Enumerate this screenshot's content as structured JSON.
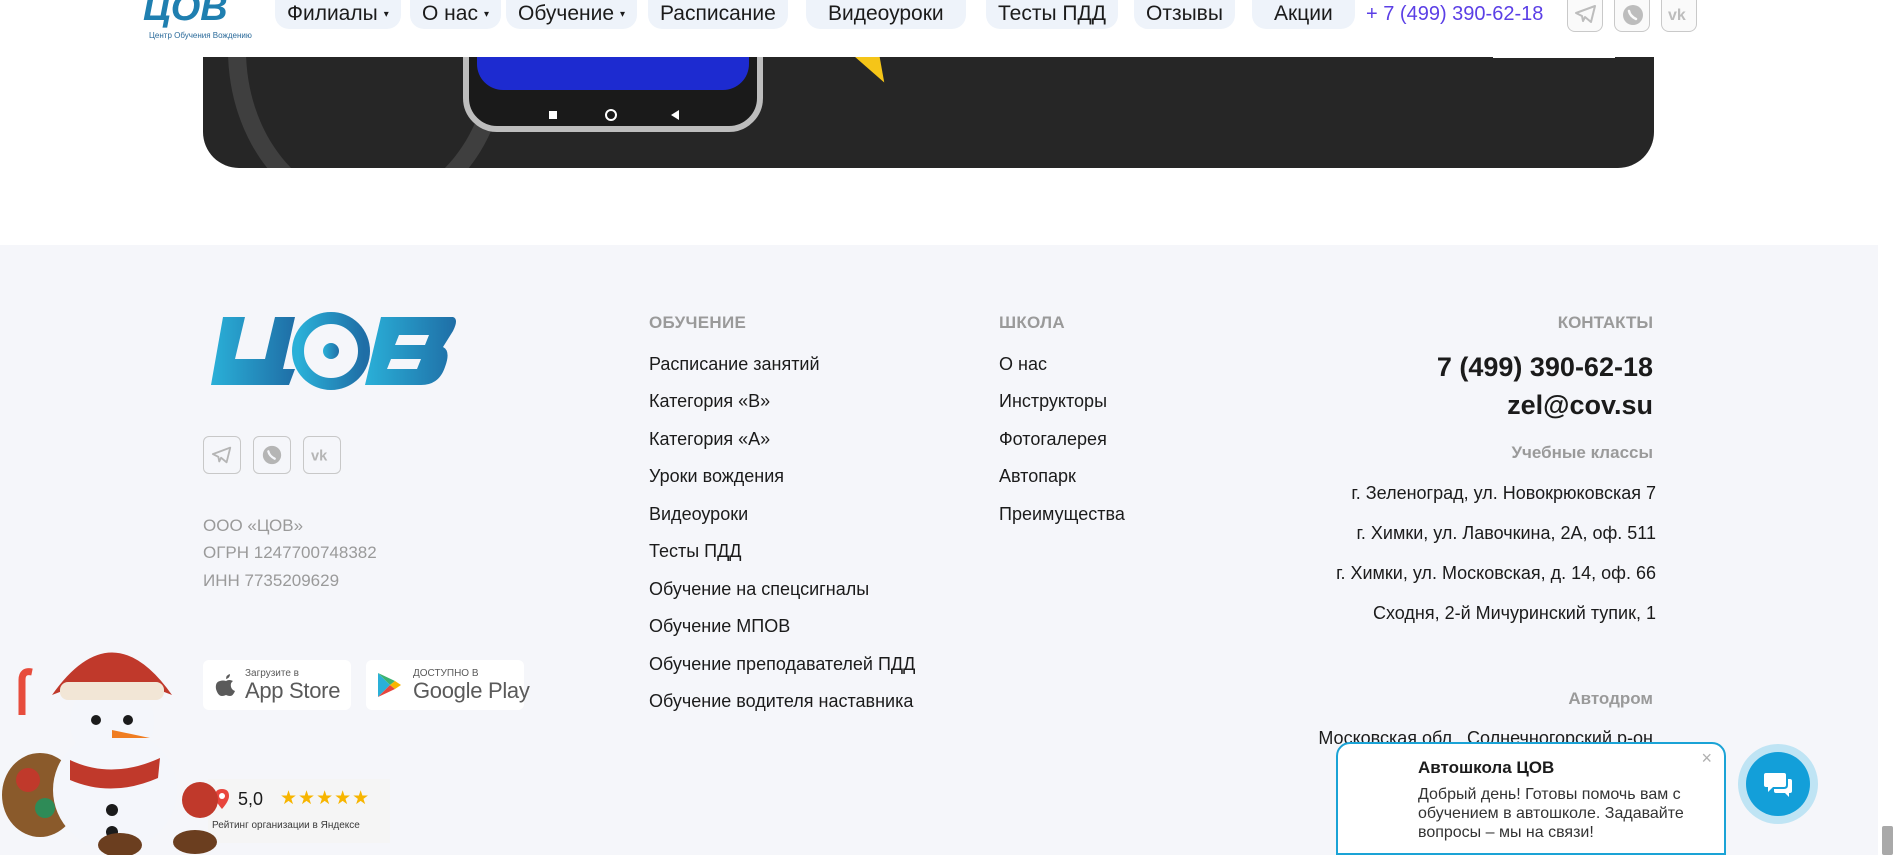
{
  "nav": {
    "logo_caption": "Центр Обучения Вождению",
    "items": [
      {
        "label": "Филиалы",
        "caret": "▾"
      },
      {
        "label": "О нас",
        "caret": "▾"
      },
      {
        "label": "Обучение",
        "caret": "▾"
      },
      {
        "label": "Расписание"
      },
      {
        "label": "Видеоуроки"
      },
      {
        "label": "Тесты ПДД"
      },
      {
        "label": "Отзывы"
      },
      {
        "label": "Акции"
      }
    ],
    "phone": "+ 7 (499) 390-62-18",
    "social_icons": [
      "telegram-icon",
      "whatsapp-icon",
      "vk-icon"
    ]
  },
  "footer": {
    "social_icons": [
      "telegram-icon",
      "whatsapp-icon",
      "vk-icon"
    ],
    "legal": [
      "ООО «ЦОВ»",
      "ОГРН 1247700748382",
      "ИНН 7735209629"
    ],
    "app_store": {
      "small": "Загрузите в",
      "big": "App Store"
    },
    "google_play": {
      "small": "ДОСТУПНО В",
      "big": "Google Play"
    },
    "education": {
      "heading": "ОБУЧЕНИЕ",
      "links": [
        "Расписание занятий",
        "Категория «B»",
        "Категория «A»",
        "Уроки вождения",
        "Видеоуроки",
        "Тесты ПДД",
        "Обучение на спецсигналы",
        "Обучение МПОВ",
        "Обучение преподавателей ПДД",
        "Обучение водителя наставника"
      ]
    },
    "school": {
      "heading": "ШКОЛА",
      "links": [
        "О нас",
        "Инструкторы",
        "Фотогалерея",
        "Автопарк",
        "Преимущества"
      ]
    },
    "contacts": {
      "heading": "КОНТАКТЫ",
      "phone": "7 (499) 390-62-18",
      "email": "zel@cov.su",
      "classes_heading": "Учебные классы",
      "addresses": [
        "г. Зеленоград, ул. Новокрюковская  7",
        "г. Химки, ул. Лавочкина, 2А, оф. 511",
        "г. Химки, ул. Московская, д. 14, оф. 66",
        "Сходня, 2-й Мичуринский тупик, 1"
      ],
      "autodrome_heading": "Автодром",
      "autodrome_address": "Московская обл., Солнечногорский р-он"
    }
  },
  "rating": {
    "score": "5,0",
    "stars": "★★★★★",
    "caption": "Рейтинг организации в Яндексе"
  },
  "chat": {
    "title": "Автошкола ЦОВ",
    "text": "Добрый день! Готовы помочь вам с обучением в автошколе. Задавайте вопросы – мы на связи!",
    "close": "×"
  },
  "colors": {
    "accent": "#5b3fe6",
    "brand_blue": "#1f7fb0",
    "chat_blue": "#139fd9",
    "footer_bg": "#f5f6fa"
  }
}
